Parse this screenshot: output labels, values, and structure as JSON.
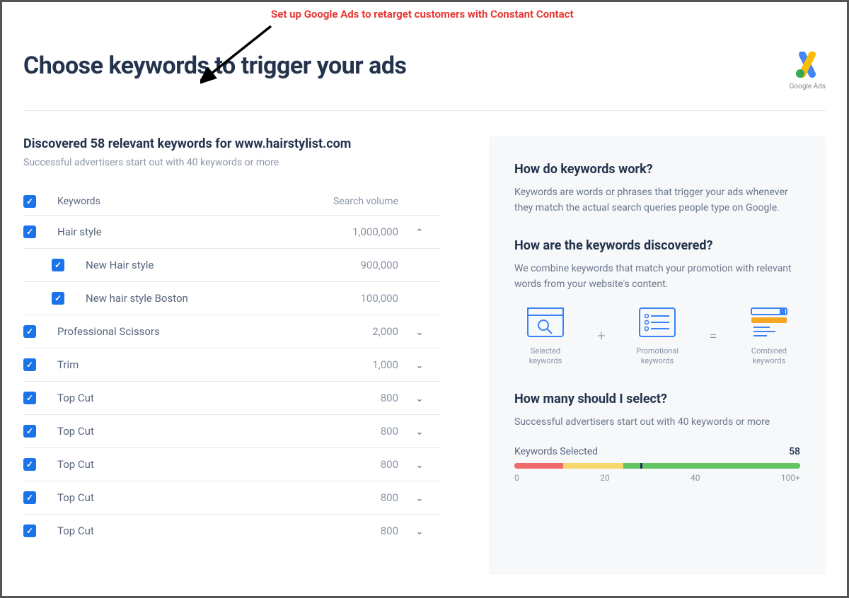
{
  "annotation": "Set up Google Ads to retarget customers with Constant Contact",
  "header": {
    "title": "Choose keywords to trigger your ads",
    "logo_caption": "Google Ads"
  },
  "discovered": {
    "title": "Discovered 58 relevant keywords for www.hairstylist.com",
    "subtitle": "Successful advertisers start out with 40 keywords or more"
  },
  "table": {
    "col_keywords": "Keywords",
    "col_volume": "Search volume",
    "rows": [
      {
        "name": "Hair style",
        "volume": "1,000,000",
        "expanded": true,
        "children": [
          {
            "name": "New Hair style",
            "volume": "900,000"
          },
          {
            "name": "New hair style Boston",
            "volume": "100,000"
          }
        ]
      },
      {
        "name": "Professional Scissors",
        "volume": "2,000"
      },
      {
        "name": "Trim",
        "volume": "1,000"
      },
      {
        "name": "Top Cut",
        "volume": "800"
      },
      {
        "name": "Top Cut",
        "volume": "800"
      },
      {
        "name": "Top Cut",
        "volume": "800"
      },
      {
        "name": "Top Cut",
        "volume": "800"
      },
      {
        "name": "Top Cut",
        "volume": "800"
      }
    ]
  },
  "help": {
    "q1": "How do keywords work?",
    "a1": "Keywords are words or phrases that trigger your ads whenever they match the actual search queries people type on Google.",
    "q2": "How are the keywords discovered?",
    "a2": "We combine keywords that match your promotion with relevant words from your website's content.",
    "eq": {
      "item1": "Selected keywords",
      "item2": "Promotional keywords",
      "item3": "Combined keywords",
      "plus": "+",
      "equals": "="
    },
    "q3": "How many should I select?",
    "a3": "Successful advertisers start out with 40 keywords or more",
    "slider_label": "Keywords Selected",
    "slider_value": "58",
    "ticks": {
      "t0": "0",
      "t1": "20",
      "t2": "40",
      "t3": "100+"
    }
  }
}
